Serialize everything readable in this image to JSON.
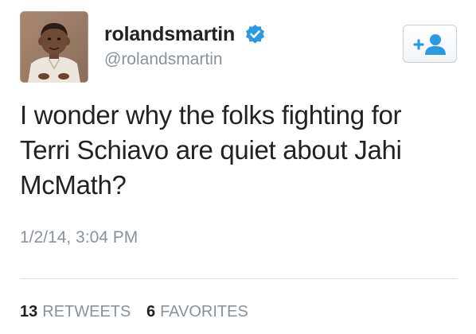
{
  "user": {
    "display_name": "rolandsmartin",
    "handle": "@rolandsmartin",
    "verified": true,
    "avatar_icon": "childhood-portrait-photo",
    "verified_icon": "verified-badge-icon",
    "verified_color": "#2a9be0"
  },
  "follow_button": {
    "icon": "follow-user-icon",
    "glyph": "+",
    "color": "#2a9be0"
  },
  "tweet": {
    "lines": [
      "I wonder why the folks fighting for",
      "Terri Schiavo are quiet about Jahi",
      "McMath?"
    ],
    "timestamp": "1/2/14, 3:04 PM"
  },
  "stats": {
    "retweets_count": "13",
    "retweets_label": "RETWEETS",
    "favorites_count": "6",
    "favorites_label": "FAVORITES"
  }
}
